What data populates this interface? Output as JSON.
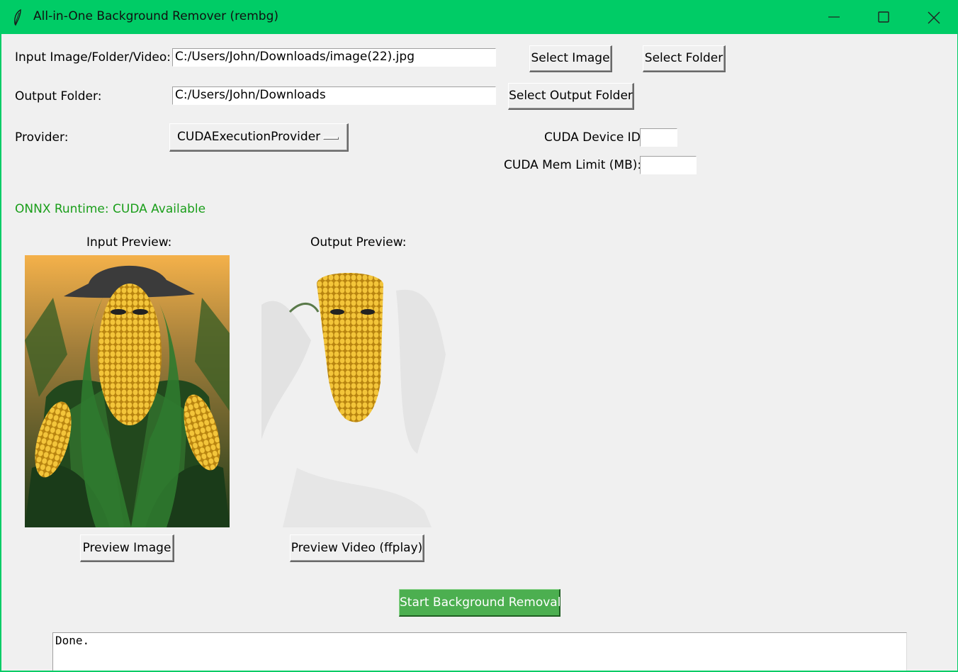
{
  "window": {
    "title": "All-in-One Background Remover (rembg)",
    "accent": "#00cc66"
  },
  "titlebar": {
    "minimize_icon": "minimize-icon",
    "maximize_icon": "maximize-icon",
    "close_icon": "close-icon"
  },
  "form": {
    "input_label": "Input Image/Folder/Video:",
    "input_value": "C:/Users/John/Downloads/image(22).jpg",
    "select_image": "Select Image",
    "select_folder": "Select Folder",
    "output_label": "Output Folder:",
    "output_value": "C:/Users/John/Downloads",
    "select_output": "Select Output Folder",
    "provider_label": "Provider:",
    "provider_value": "CUDAExecutionProvider",
    "cuda_device_label": "CUDA Device ID:",
    "cuda_device_value": "",
    "cuda_mem_label": "CUDA Mem Limit (MB):",
    "cuda_mem_value": ""
  },
  "status": {
    "onnx": "ONNX Runtime: CUDA Available",
    "onnx_color": "#1a9e1a"
  },
  "previews": {
    "input_label": "Input Preview:",
    "output_label": "Output Preview:",
    "preview_image_btn": "Preview Image",
    "preview_video_btn": "Preview Video (ffplay)"
  },
  "actions": {
    "start": "Start Background Removal",
    "start_color": "#4caf50"
  },
  "log": {
    "text": "Done."
  }
}
